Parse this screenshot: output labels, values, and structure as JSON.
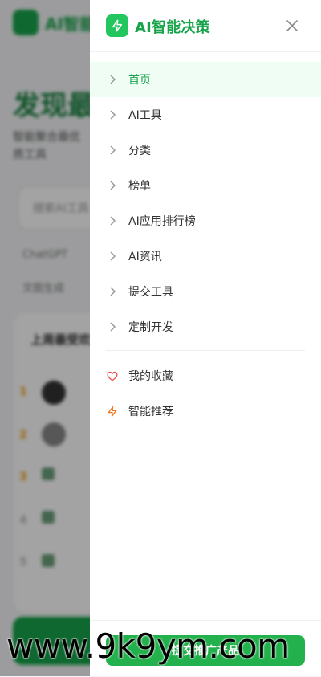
{
  "background": {
    "logo_text": "AI智能",
    "hero_title": "发现最佳",
    "subtitle": "智能聚合最优质工具",
    "search_placeholder": "搜索AI工具",
    "chips": [
      "ChatGPT",
      "文图生成"
    ],
    "card_title": "上周最受欢迎",
    "ranks": [
      "1",
      "2",
      "3",
      "4",
      "5"
    ]
  },
  "drawer": {
    "title": "AI智能决策",
    "nav_items": [
      {
        "label": "首页",
        "active": true
      },
      {
        "label": "AI工具"
      },
      {
        "label": "分类"
      },
      {
        "label": "榜单"
      },
      {
        "label": "AI应用排行榜"
      },
      {
        "label": "AI资讯"
      },
      {
        "label": "提交工具"
      },
      {
        "label": "定制开发"
      }
    ],
    "extra_items": [
      {
        "label": "我的收藏",
        "icon": "heart-icon",
        "color": "#ef4444"
      },
      {
        "label": "智能推荐",
        "icon": "lightning-icon",
        "color": "#f97316"
      }
    ],
    "promo_button": "提交推广产品"
  },
  "watermark": "www.9k9ym.com",
  "colors": {
    "brand_green": "#16a34a",
    "active_bg": "#f0fdf4",
    "heart_red": "#ef4444",
    "bolt_orange": "#f97316"
  }
}
